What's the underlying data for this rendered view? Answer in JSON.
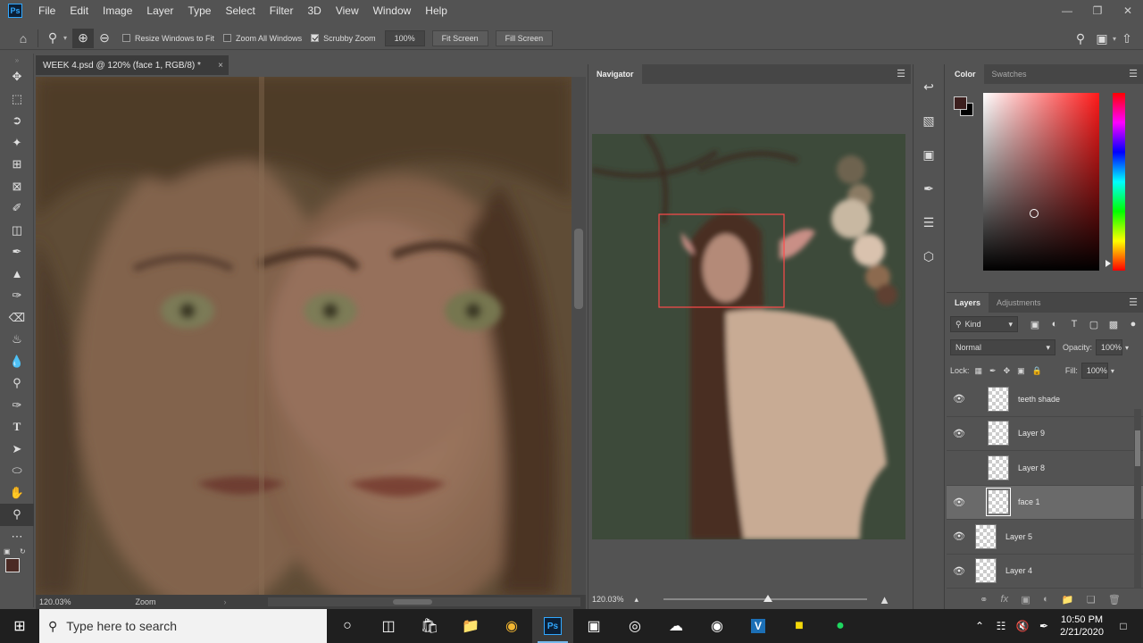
{
  "app": {
    "name": "Ps"
  },
  "menu": [
    "File",
    "Edit",
    "Image",
    "Layer",
    "Type",
    "Select",
    "Filter",
    "3D",
    "View",
    "Window",
    "Help"
  ],
  "options": {
    "resize_windows": "Resize Windows to Fit",
    "zoom_all_windows": "Zoom All Windows",
    "scrubby_zoom": "Scrubby Zoom",
    "zoom_value": "100%",
    "fit_screen": "Fit Screen",
    "fill_screen": "Fill Screen"
  },
  "document": {
    "tab_title": "WEEK 4.psd @ 120% (face 1, RGB/8) *",
    "close": "×",
    "status_zoom": "120.03%",
    "status_tool": "Zoom"
  },
  "navigator": {
    "tab": "Navigator",
    "zoom": "120.03%"
  },
  "color_panel": {
    "tabs": [
      "Color",
      "Swatches"
    ],
    "foreground": "#3c1f1e",
    "background": "#000000"
  },
  "layers_panel": {
    "tabs": [
      "Layers",
      "Adjustments"
    ],
    "filter_kind": "Kind",
    "blend_mode": "Normal",
    "opacity_label": "Opacity:",
    "opacity": "100%",
    "lock_label": "Lock:",
    "fill_label": "Fill:",
    "fill": "100%",
    "layers": [
      {
        "name": "teeth shade",
        "visible": true,
        "selected": false
      },
      {
        "name": "Layer 9",
        "visible": true,
        "selected": false
      },
      {
        "name": "Layer 8",
        "visible": false,
        "selected": false
      },
      {
        "name": "face 1",
        "visible": true,
        "selected": true
      },
      {
        "name": "Layer 5",
        "visible": true,
        "selected": false
      },
      {
        "name": "Layer 4",
        "visible": true,
        "selected": false
      }
    ]
  },
  "taskbar": {
    "search_placeholder": "Type here to search",
    "time": "10:50 PM",
    "date": "2/21/2020"
  }
}
